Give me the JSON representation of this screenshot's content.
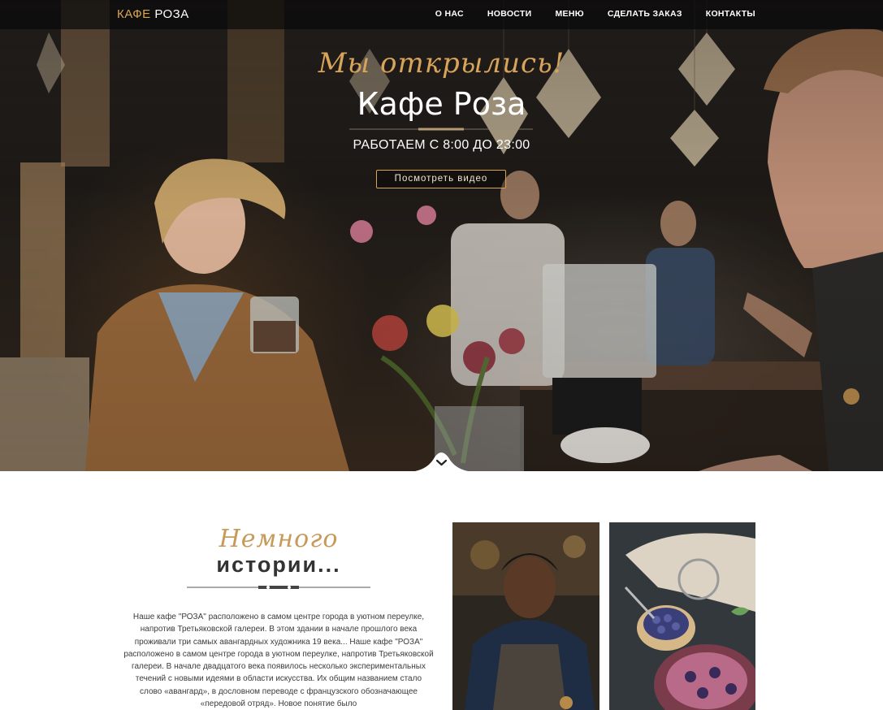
{
  "header": {
    "logo_part1": "КАФЕ",
    "logo_part2": "РОЗА",
    "nav": [
      {
        "label": "О НАС"
      },
      {
        "label": "НОВОСТИ"
      },
      {
        "label": "МЕНЮ"
      },
      {
        "label": "СДЕЛАТЬ ЗАКАЗ"
      },
      {
        "label": "КОНТАКТЫ"
      }
    ]
  },
  "hero": {
    "script_title": "Мы открылись!",
    "title": "Кафе Роза",
    "hours": "РАБОТАЕМ С 8:00 ДО 23:00",
    "video_button": "Посмотреть видео",
    "scroll_icon": "chevron-down-icon"
  },
  "history": {
    "script_title": "Немного",
    "title": "истории...",
    "body": "Наше кафе \"РОЗА\" расположено в самом центре города в уютном переулке, напротив Третьяковской галереи. В этом здании в начале прошлого века проживали три самых авангардных художника 19 века... Наше кафе \"РОЗА\" расположено в самом центре города в уютном переулке, напротив Третьяковской галереи. В начале двадцатого века появилось несколько экспериментальных течений с новыми идеями в области искусства. Их общим названием стало слово «авангард», в дословном переводе с французского обозначающее «передовой отряд». Новое понятие было"
  },
  "colors": {
    "accent_gold": "#d8a45a",
    "nav_bg": "#0a0a0a",
    "text_dark": "#333333"
  }
}
